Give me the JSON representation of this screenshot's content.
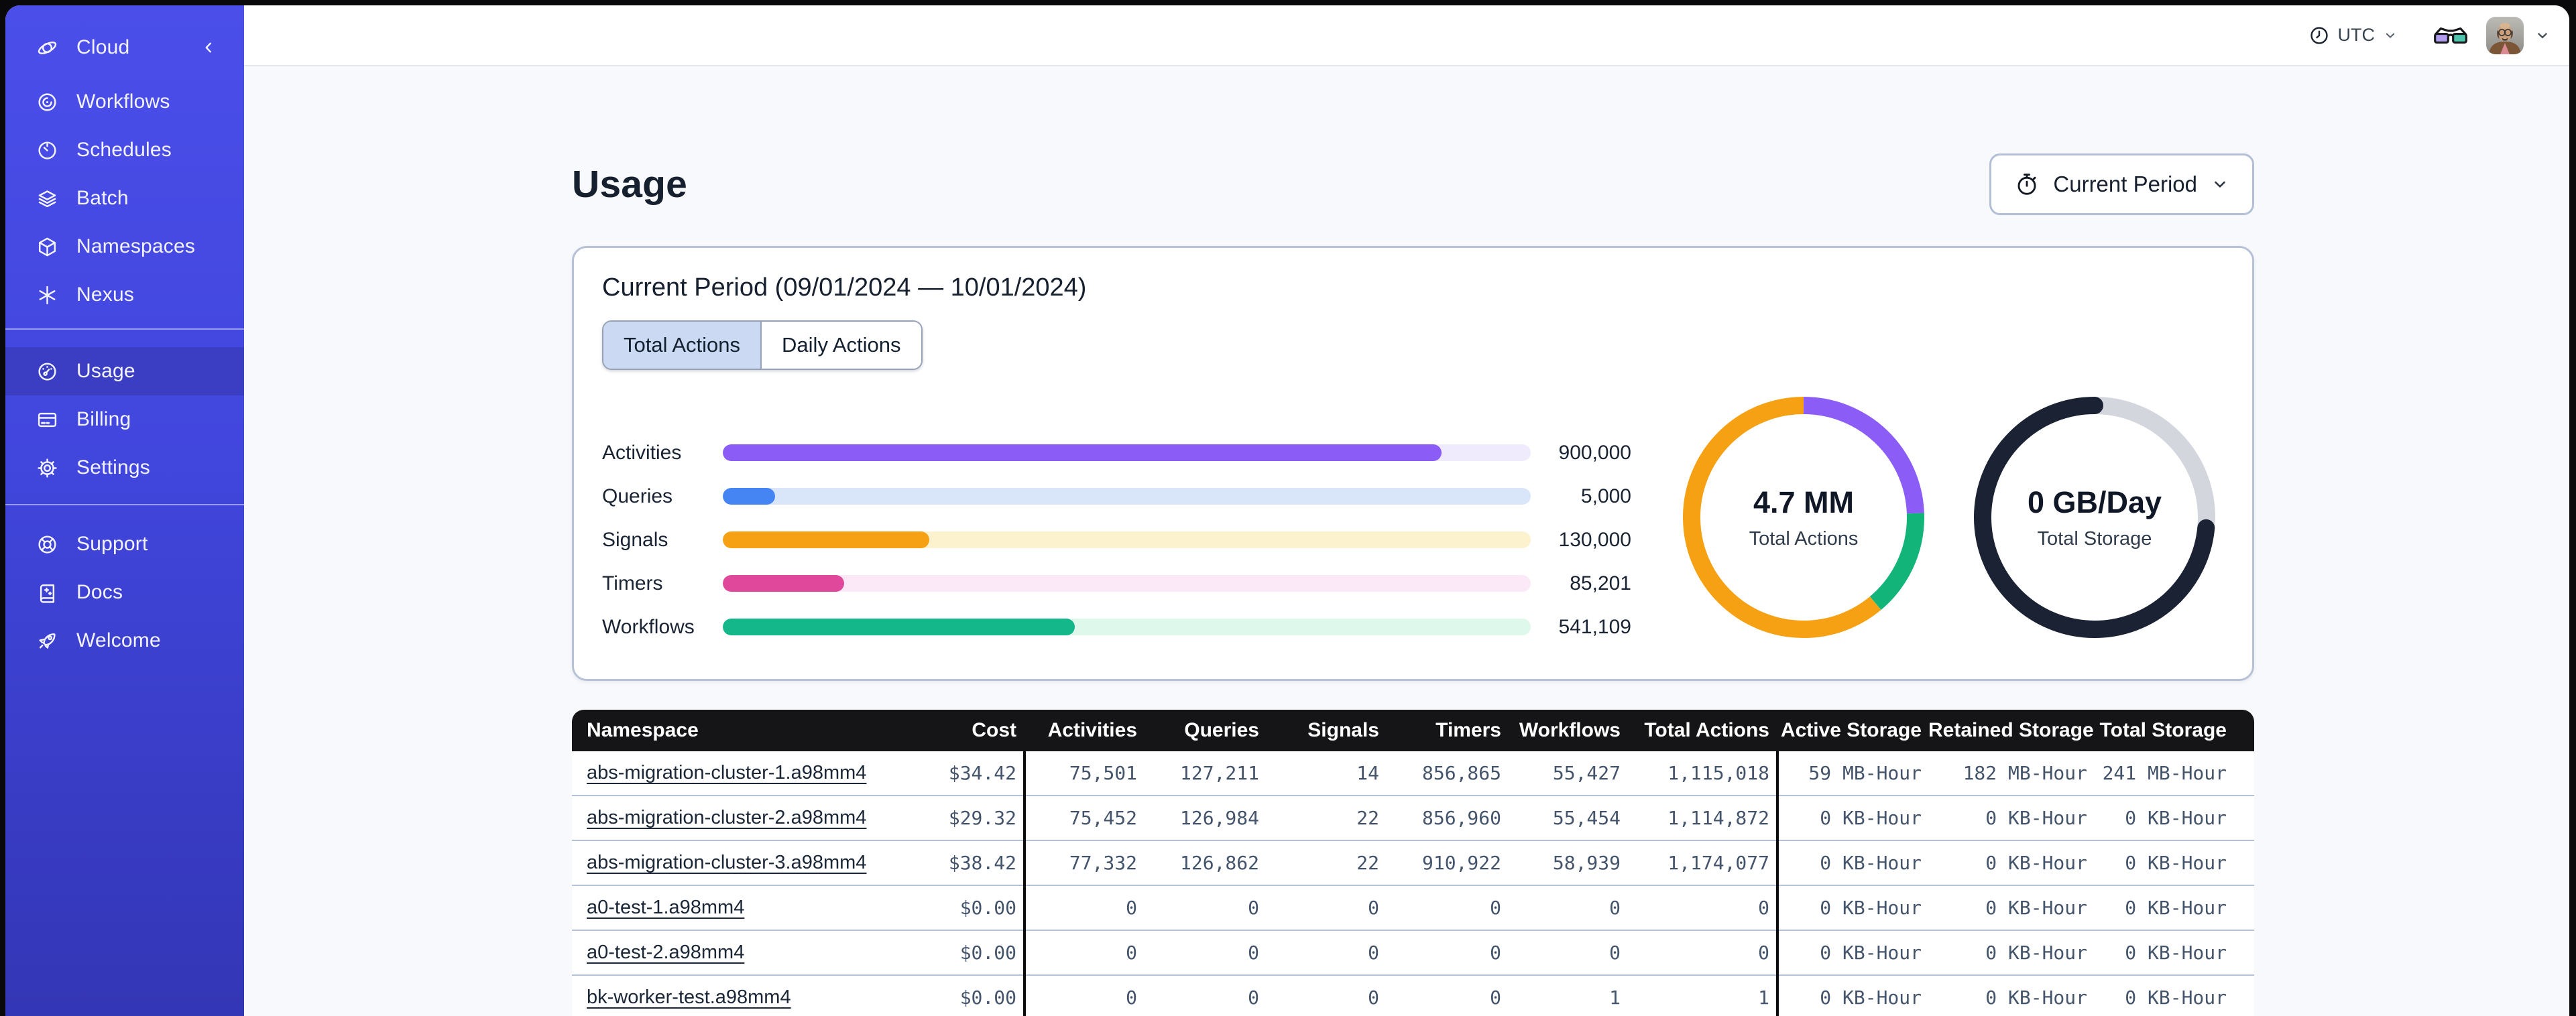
{
  "sidebar": {
    "header": {
      "label": "Cloud",
      "icon": "temporal-cloud",
      "collapse_icon": "chevron-left"
    },
    "groups": [
      {
        "name": "primary",
        "items": [
          {
            "label": "Workflows",
            "icon": "workflows",
            "selected": false
          },
          {
            "label": "Schedules",
            "icon": "schedules",
            "selected": false
          },
          {
            "label": "Batch",
            "icon": "batch",
            "selected": false
          },
          {
            "label": "Namespaces",
            "icon": "namespaces",
            "selected": false
          },
          {
            "label": "Nexus",
            "icon": "nexus",
            "selected": false
          }
        ]
      },
      {
        "name": "account",
        "items": [
          {
            "label": "Usage",
            "icon": "usage",
            "selected": true
          },
          {
            "label": "Billing",
            "icon": "billing",
            "selected": false
          },
          {
            "label": "Settings",
            "icon": "settings",
            "selected": false
          }
        ]
      },
      {
        "name": "help",
        "items": [
          {
            "label": "Support",
            "icon": "support",
            "selected": false
          },
          {
            "label": "Docs",
            "icon": "docs",
            "selected": false
          },
          {
            "label": "Welcome",
            "icon": "welcome",
            "selected": false
          }
        ]
      }
    ],
    "colors": {
      "bg_top": "#4B4EE9",
      "bg_bottom": "#3336B5",
      "selected_bg": "#3B3EC2"
    }
  },
  "topbar": {
    "timezone_label": "UTC"
  },
  "page": {
    "title": "Usage",
    "period_button": {
      "label": "Current Period",
      "icon": "stopwatch"
    }
  },
  "card": {
    "title": "Current Period (09/01/2024 — 10/01/2024)",
    "tabs": [
      {
        "label": "Total Actions",
        "selected": true
      },
      {
        "label": "Daily Actions",
        "selected": false
      }
    ]
  },
  "chart_data": [
    {
      "type": "bar",
      "title": "Total Actions by type",
      "orientation": "horizontal",
      "rows": [
        {
          "label": "Activities",
          "value": 900000,
          "value_label": "900,000",
          "fill_pct": 89,
          "color": "#8B5CF6",
          "track_color": "#EFEBFC"
        },
        {
          "label": "Queries",
          "value": 5000,
          "value_label": "5,000",
          "fill_pct": 6.5,
          "color": "#4484F3",
          "track_color": "#D9E6FA"
        },
        {
          "label": "Signals",
          "value": 130000,
          "value_label": "130,000",
          "fill_pct": 25.6,
          "color": "#F5A113",
          "track_color": "#FCF2CE"
        },
        {
          "label": "Timers",
          "value": 85201,
          "value_label": "85,201",
          "fill_pct": 15,
          "color": "#E0489B",
          "track_color": "#FCE9F8"
        },
        {
          "label": "Workflows",
          "value": 541109,
          "value_label": "541,109",
          "fill_pct": 43.6,
          "color": "#14B789",
          "track_color": "#DFF8EC"
        }
      ]
    },
    {
      "type": "donut",
      "center_value": "4.7 MM",
      "center_label": "Total Actions",
      "segments": [
        {
          "color": "#8B5CF6",
          "pct": 24.4,
          "rounded": false
        },
        {
          "color": "#12B479",
          "pct": 14.5,
          "rounded": false
        },
        {
          "color": "#F5A113",
          "pct": 61.1,
          "rounded": false
        }
      ]
    },
    {
      "type": "donut",
      "center_value": "0 GB/Day",
      "center_label": "Total Storage",
      "segments": [
        {
          "color": "#D3D6DD",
          "pct": 26.5,
          "rounded": false
        },
        {
          "color": "#1A2233",
          "pct": 73.5,
          "rounded": true
        }
      ]
    }
  ],
  "table": {
    "columns": [
      {
        "label": "Namespace",
        "align": "left"
      },
      {
        "label": "Cost",
        "align": "right"
      },
      {
        "label": "Activities",
        "align": "right"
      },
      {
        "label": "Queries",
        "align": "right"
      },
      {
        "label": "Signals",
        "align": "right"
      },
      {
        "label": "Timers",
        "align": "right"
      },
      {
        "label": "Workflows",
        "align": "right"
      },
      {
        "label": "Total Actions",
        "align": "right"
      },
      {
        "label": "Active Storage",
        "align": "right"
      },
      {
        "label": "Retained Storage",
        "align": "right"
      },
      {
        "label": "Total Storage",
        "align": "right"
      }
    ],
    "rows": [
      {
        "namespace": "abs-migration-cluster-1.a98mm4",
        "cells": [
          "$34.42",
          "75,501",
          "127,211",
          "14",
          "856,865",
          "55,427",
          "1,115,018",
          "59 MB-Hour",
          "182 MB-Hour",
          "241 MB-Hour"
        ]
      },
      {
        "namespace": "abs-migration-cluster-2.a98mm4",
        "cells": [
          "$29.32",
          "75,452",
          "126,984",
          "22",
          "856,960",
          "55,454",
          "1,114,872",
          "0 KB-Hour",
          "0 KB-Hour",
          "0 KB-Hour"
        ]
      },
      {
        "namespace": "abs-migration-cluster-3.a98mm4",
        "cells": [
          "$38.42",
          "77,332",
          "126,862",
          "22",
          "910,922",
          "58,939",
          "1,174,077",
          "0 KB-Hour",
          "0 KB-Hour",
          "0 KB-Hour"
        ]
      },
      {
        "namespace": "a0-test-1.a98mm4",
        "cells": [
          "$0.00",
          "0",
          "0",
          "0",
          "0",
          "0",
          "0",
          "0 KB-Hour",
          "0 KB-Hour",
          "0 KB-Hour"
        ]
      },
      {
        "namespace": "a0-test-2.a98mm4",
        "cells": [
          "$0.00",
          "0",
          "0",
          "0",
          "0",
          "0",
          "0",
          "0 KB-Hour",
          "0 KB-Hour",
          "0 KB-Hour"
        ]
      },
      {
        "namespace": "bk-worker-test.a98mm4",
        "cells": [
          "$0.00",
          "0",
          "0",
          "0",
          "0",
          "1",
          "1",
          "0 KB-Hour",
          "0 KB-Hour",
          "0 KB-Hour"
        ]
      }
    ]
  }
}
